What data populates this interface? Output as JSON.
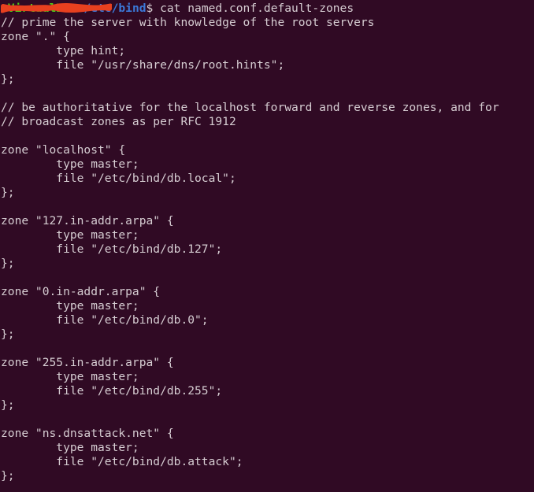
{
  "terminal": {
    "colors": {
      "background": "#300a24",
      "foreground": "#d6cdd2",
      "prompt_user_host": "#4ec817",
      "prompt_path": "#3b78d8",
      "redaction": "#e8401f"
    },
    "prompt": {
      "user_host": "",
      "host_suffix": "-VirtualBox",
      "separator": ":",
      "path": "/etc/bind",
      "sigil": "$",
      "command": " cat named.conf.default-zones",
      "redacted_note": "username and hostname obscured by red scribble"
    },
    "output_lines": [
      "// prime the server with knowledge of the root servers",
      "zone \".\" {",
      "        type hint;",
      "        file \"/usr/share/dns/root.hints\";",
      "};",
      "",
      "// be authoritative for the localhost forward and reverse zones, and for",
      "// broadcast zones as per RFC 1912",
      "",
      "zone \"localhost\" {",
      "        type master;",
      "        file \"/etc/bind/db.local\";",
      "};",
      "",
      "zone \"127.in-addr.arpa\" {",
      "        type master;",
      "        file \"/etc/bind/db.127\";",
      "};",
      "",
      "zone \"0.in-addr.arpa\" {",
      "        type master;",
      "        file \"/etc/bind/db.0\";",
      "};",
      "",
      "zone \"255.in-addr.arpa\" {",
      "        type master;",
      "        file \"/etc/bind/db.255\";",
      "};",
      "",
      "zone \"ns.dnsattack.net\" {",
      "        type master;",
      "        file \"/etc/bind/db.attack\";",
      "};"
    ]
  }
}
